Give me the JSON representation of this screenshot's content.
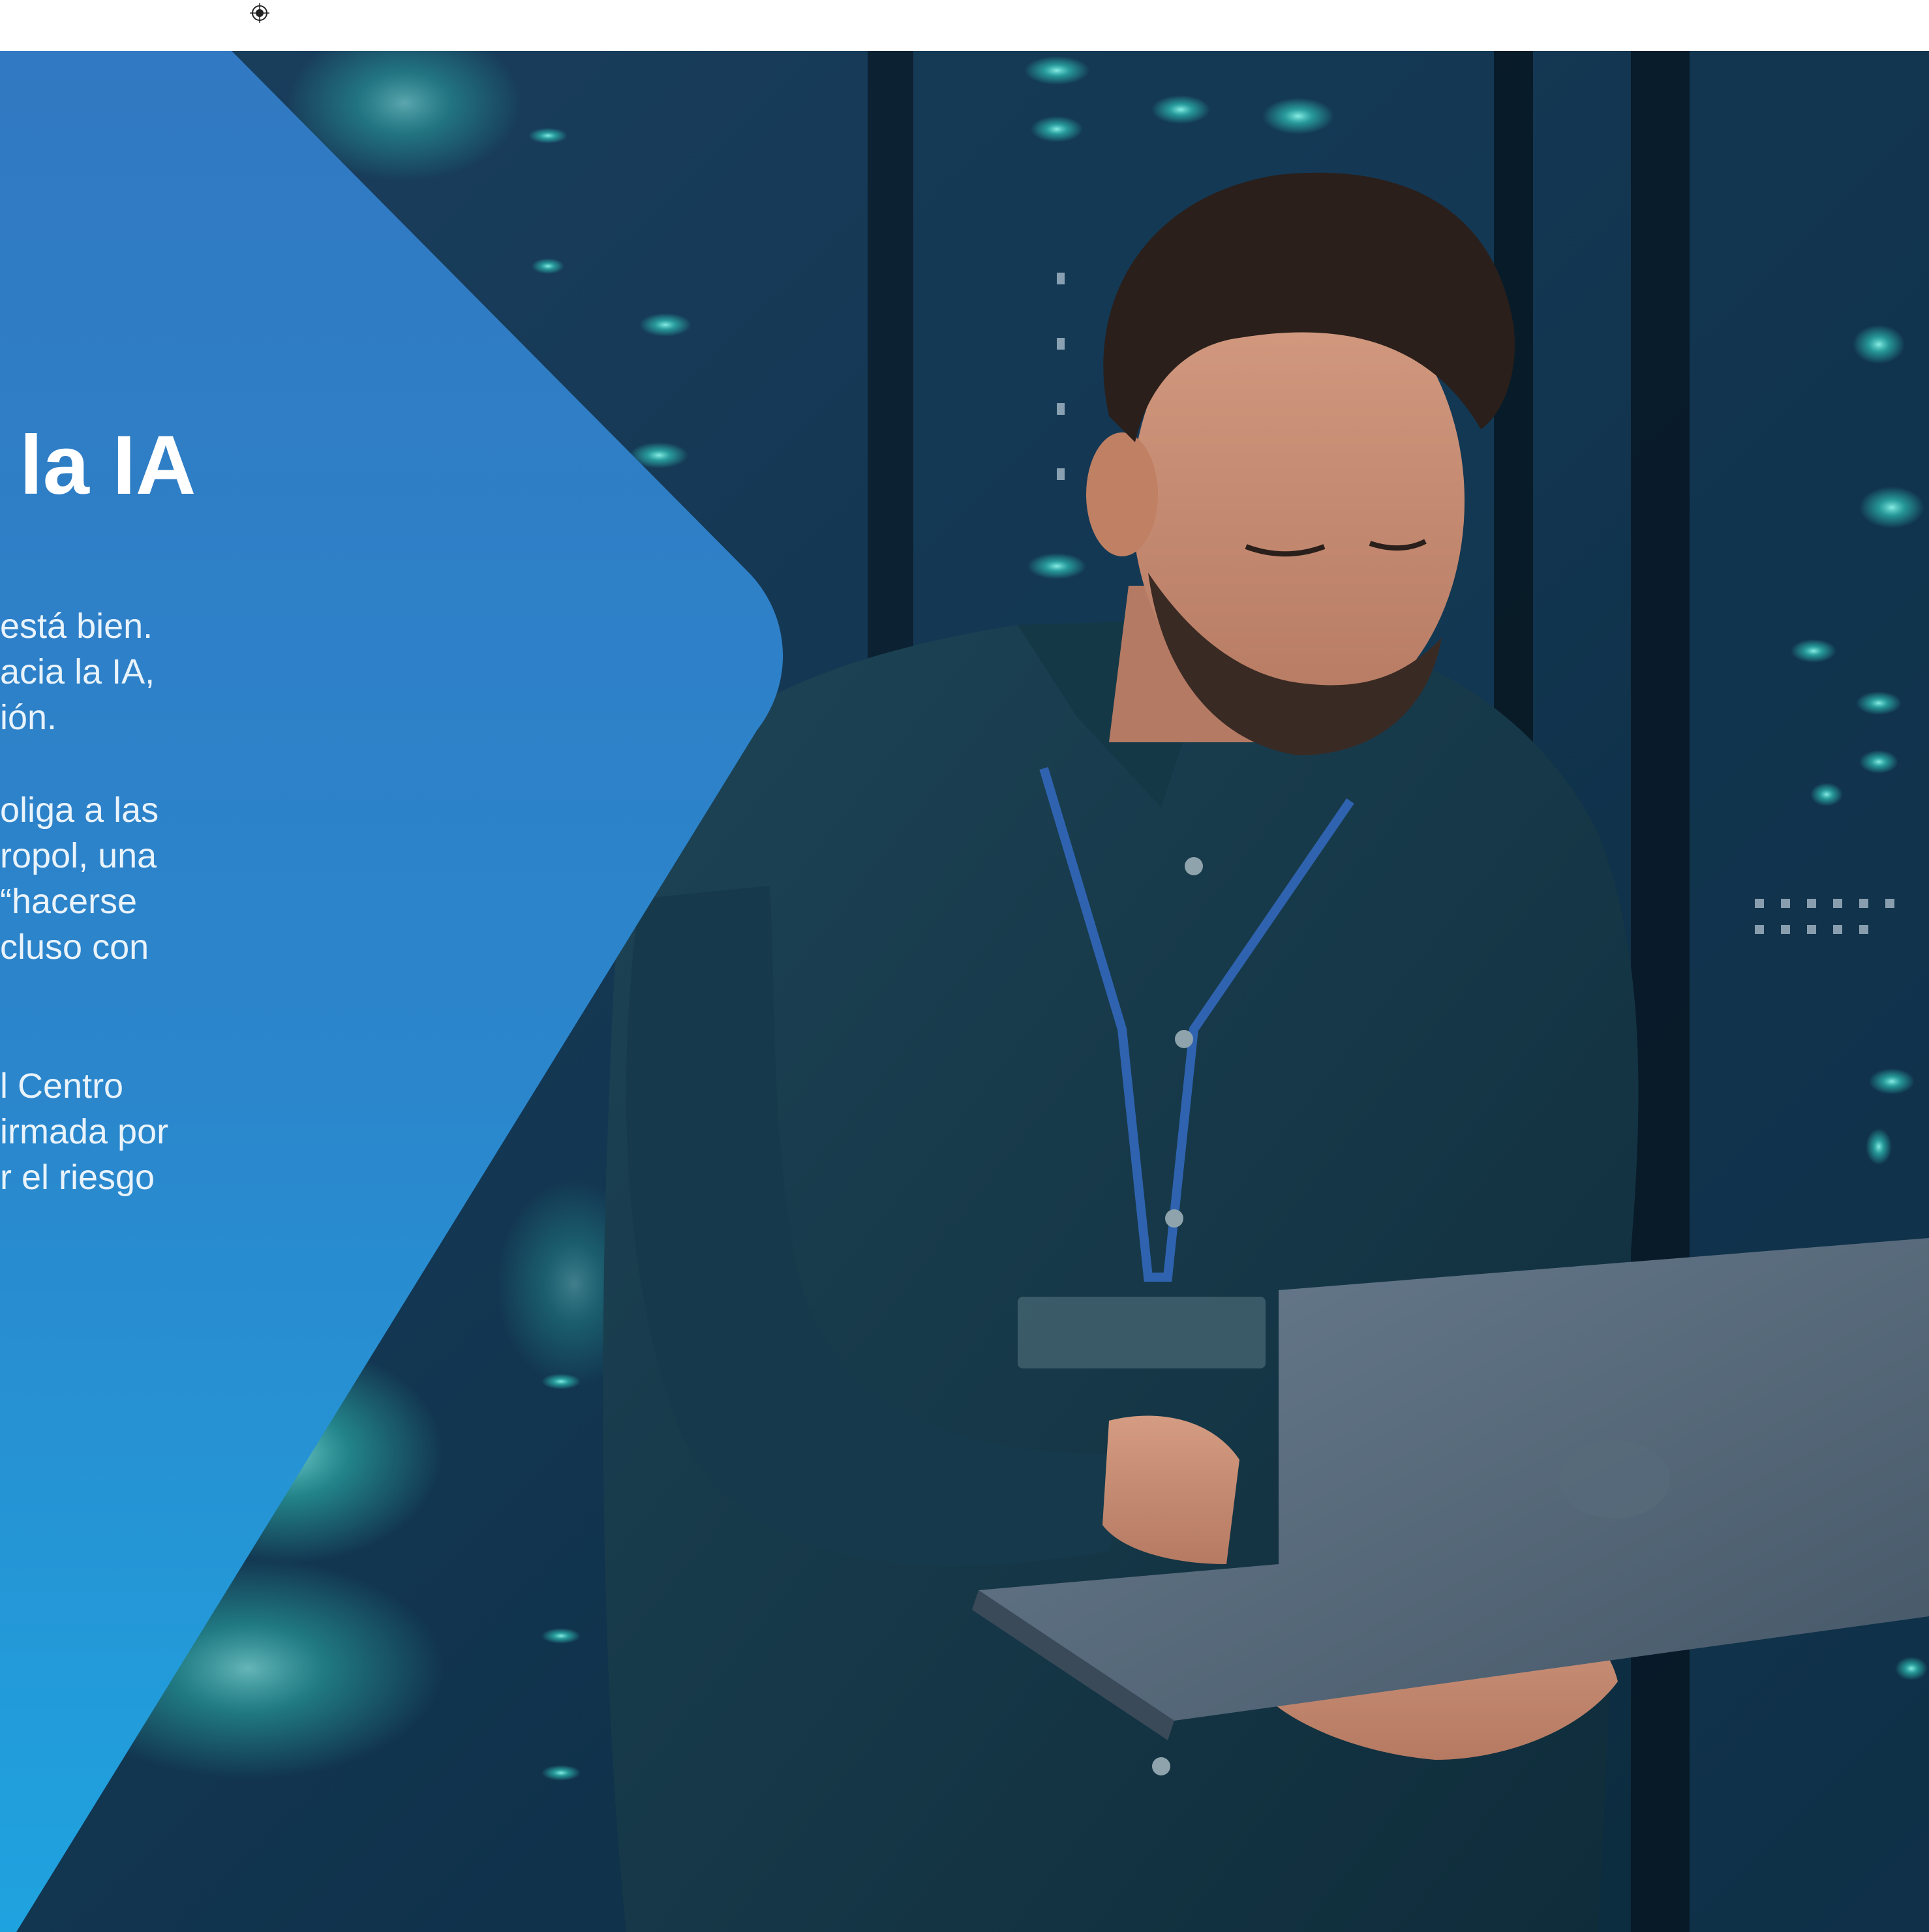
{
  "article": {
    "headline": "la IA",
    "paragraph_1": [
      "está bien.",
      "acia la IA,",
      "ión."
    ],
    "paragraph_2": [
      "oliga a las",
      "ropol, una",
      "“hacerse",
      "cluso con"
    ],
    "paragraph_3": [
      "l Centro",
      "irmada por",
      "r el riesgo"
    ]
  },
  "colors": {
    "panel_top": "#3179c2",
    "panel_bottom": "#1fa3df",
    "background_dark": "#0f2d45",
    "shirt": "#163a4b",
    "laptop": "#5b6d7d",
    "server_lights": "#3fe3d0"
  },
  "icons": {
    "registration_mark": "crosshair-target-icon"
  },
  "photo": {
    "description_subject": "man-with-laptop-in-server-room"
  }
}
